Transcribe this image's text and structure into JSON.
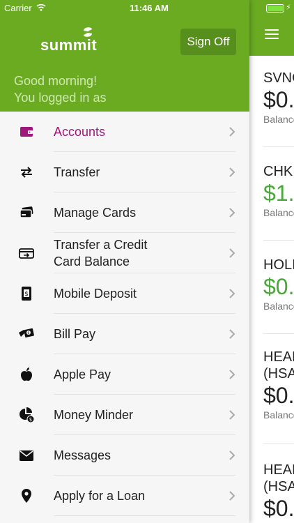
{
  "status_bar": {
    "carrier": "Carrier",
    "time": "11:46 AM"
  },
  "header": {
    "logo_text": "summit",
    "sign_off_label": "Sign Off",
    "greeting_line1": "Good morning!",
    "greeting_line2": "You logged in as"
  },
  "menu": {
    "items": [
      {
        "label": "Accounts",
        "icon": "wallet-icon"
      },
      {
        "label": "Transfer",
        "icon": "transfer-arrows-icon"
      },
      {
        "label": "Manage Cards",
        "icon": "cards-icon"
      },
      {
        "label": "Transfer a Credit Card Balance",
        "icon": "credit-card-transfer-icon"
      },
      {
        "label": "Mobile Deposit",
        "icon": "mobile-deposit-icon"
      },
      {
        "label": "Bill Pay",
        "icon": "bill-pay-icon"
      },
      {
        "label": "Apple Pay",
        "icon": "apple-icon"
      },
      {
        "label": "Money Minder",
        "icon": "money-minder-icon"
      },
      {
        "label": "Messages",
        "icon": "envelope-icon"
      },
      {
        "label": "Apply for a Loan",
        "icon": "location-pin-icon"
      }
    ]
  },
  "accounts_preview": [
    {
      "name": "SVNG",
      "amount": "$0.",
      "caption": "Balance"
    },
    {
      "name": "CHK",
      "amount": "$1.",
      "caption": "Balance"
    },
    {
      "name": "HOLI",
      "amount": "$0.",
      "caption": "Balance"
    },
    {
      "name": "HEAL",
      "name2": "(HSA",
      "amount": "$0.",
      "caption": "Balance"
    },
    {
      "name": "HEAL",
      "name2": "(HSA",
      "amount": "$0."
    }
  ],
  "colors": {
    "brand_green": "#6aab22",
    "sign_off_bg": "#578f1c",
    "active_label": "#a0177c",
    "positive_amount": "#4aa83a"
  }
}
